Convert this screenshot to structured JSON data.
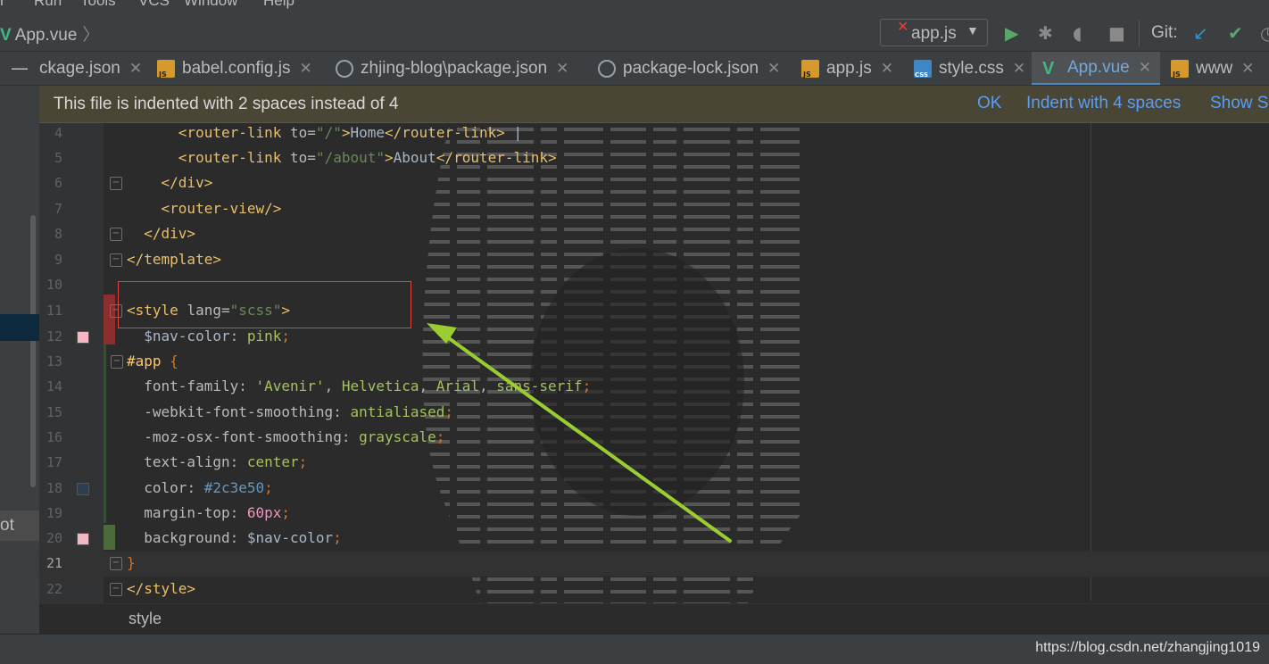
{
  "menu": [
    "r",
    "Run",
    "Tools",
    "VCS",
    "Window",
    "Help"
  ],
  "nav": {
    "breadcrumb": "App.vue",
    "run_config": "app.js",
    "git_label": "Git:"
  },
  "tabs": [
    {
      "label": "ckage.json",
      "icon": "json-file-icon",
      "active": false
    },
    {
      "label": "babel.config.js",
      "icon": "js-file-icon",
      "active": false
    },
    {
      "label": "zhjing-blog\\package.json",
      "icon": "json-file-icon",
      "active": false
    },
    {
      "label": "package-lock.json",
      "icon": "json-file-icon",
      "active": false
    },
    {
      "label": "app.js",
      "icon": "js-file-icon",
      "active": false
    },
    {
      "label": "style.css",
      "icon": "css-file-icon",
      "active": false
    },
    {
      "label": "App.vue",
      "icon": "vue-file-icon",
      "active": true
    },
    {
      "label": "www",
      "icon": "js-file-icon",
      "active": false
    }
  ],
  "notification": {
    "message": "This file is indented with 2 spaces instead of 4",
    "ok": "OK",
    "indent": "Indent with 4 spaces",
    "show": "Show Se"
  },
  "left_panel": {
    "item": "ot"
  },
  "code_lines": [
    {
      "n": "4",
      "html": "      <span class='t-tag'>&lt;router-link</span> <span class='t-attr'>to=</span><span class='t-str'>\"/\"</span><span class='t-tag'>&gt;</span><span class='t-txt'>Home</span><span class='t-tag'>&lt;/router-link&gt;</span> |"
    },
    {
      "n": "5",
      "html": "      <span class='t-tag'>&lt;router-link</span> <span class='t-attr'>to=</span><span class='t-str'>\"/about\"</span><span class='t-tag'>&gt;</span><span class='t-txt'>About</span><span class='t-tag'>&lt;/router-link&gt;</span>"
    },
    {
      "n": "6",
      "html": "    <span class='t-tag'>&lt;/div&gt;</span>"
    },
    {
      "n": "7",
      "html": "    <span class='t-tag'>&lt;router-view/&gt;</span>"
    },
    {
      "n": "8",
      "html": "  <span class='t-tag'>&lt;/div&gt;</span>"
    },
    {
      "n": "9",
      "html": "<span class='t-tag'>&lt;/template&gt;</span>"
    },
    {
      "n": "10",
      "html": ""
    },
    {
      "n": "11",
      "html": "<span class='t-tag'>&lt;style</span> <span class='t-attr'>lang=</span><span class='t-str'>\"scss\"</span><span class='t-tag'>&gt;</span>"
    },
    {
      "n": "12",
      "html": "  <span class='t-var'>$nav-color</span>: <span class='t-val'>pink</span><span class='t-punc'>;</span>"
    },
    {
      "n": "13",
      "html": "<span class='t-sel'>#app</span> <span class='t-punc'>{</span>"
    },
    {
      "n": "14",
      "html": "  <span class='t-prop'>font-family</span>: <span class='t-val'>'Avenir'</span>, <span class='t-val'>Helvetica</span>, <span class='t-val'>Arial</span>, <span class='t-val'>sans-serif</span><span class='t-punc'>;</span>"
    },
    {
      "n": "15",
      "html": "  <span class='t-prop'>-webkit-font-smoothing</span>: <span class='t-val'>antialiased</span><span class='t-punc'>;</span>"
    },
    {
      "n": "16",
      "html": "  <span class='t-prop'>-moz-osx-font-smoothing</span>: <span class='t-val'>grayscale</span><span class='t-punc'>;</span>"
    },
    {
      "n": "17",
      "html": "  <span class='t-prop'>text-align</span>: <span class='t-val'>center</span><span class='t-punc'>;</span>"
    },
    {
      "n": "18",
      "html": "  <span class='t-prop'>color</span>: <span class='t-hex'>#2c3e50</span><span class='t-punc'>;</span>"
    },
    {
      "n": "19",
      "html": "  <span class='t-prop'>margin-top</span>: <span class='t-pink'>60px</span><span class='t-punc'>;</span>"
    },
    {
      "n": "20",
      "html": "  <span class='t-prop'>background</span>: <span class='t-var'>$nav-color</span><span class='t-punc'>;</span>"
    },
    {
      "n": "21",
      "html": "<span class='t-punc'>}</span>"
    },
    {
      "n": "22",
      "html": "<span class='t-tag'>&lt;/style&gt;</span>"
    }
  ],
  "bottom_breadcrumb": "style",
  "watermark_url": "https://blog.csdn.net/zhangjing1019",
  "colors": {
    "swatch_pink": "#f4b8c4",
    "swatch_dark": "#2c3e50",
    "accent_arrow": "#9acd32",
    "highlight_box": "#e34040"
  }
}
